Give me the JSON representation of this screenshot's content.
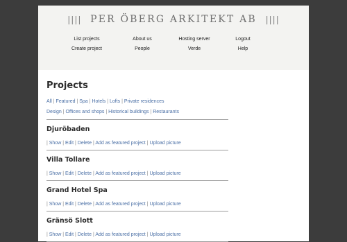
{
  "brand": {
    "name": "PER ÖBERG ARKITEKT AB",
    "bars": "||||"
  },
  "nav": {
    "columns": [
      [
        "List projects",
        "Create project"
      ],
      [
        "About us",
        "People"
      ],
      [
        "Hosting server",
        "Verde"
      ],
      [
        "Logout",
        "Help"
      ]
    ]
  },
  "main": {
    "title": "Projects",
    "filters_row1": [
      "All",
      "Featured",
      "Spa",
      "Hotels",
      "Lofts",
      "Private residences"
    ],
    "filters_row2": [
      "Design",
      "Offices and shops",
      "Historical buildings",
      "Restaurants"
    ],
    "actions": [
      "Show",
      "Edit",
      "Delete",
      "Add as featured project",
      "Upload picture"
    ],
    "projects": [
      "Djuröbaden",
      "Villa Tollare",
      "Grand Hotel Spa",
      "Gränsö Slott"
    ]
  },
  "colors": {
    "background": "#3c3c3c",
    "header": "#f3f3f1",
    "link": "#4a6fa5"
  }
}
